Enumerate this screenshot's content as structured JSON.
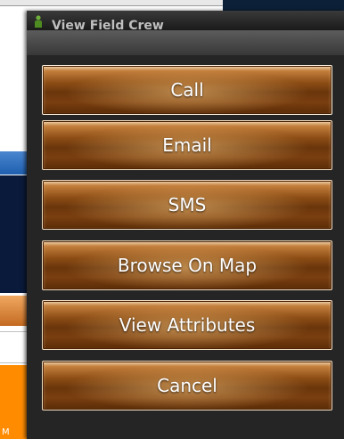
{
  "dialog": {
    "title": "View Field Crew"
  },
  "menu": {
    "items": [
      {
        "label": "Call"
      },
      {
        "label": "Email"
      },
      {
        "label": "SMS"
      },
      {
        "label": "Browse On Map"
      },
      {
        "label": "View Attributes"
      },
      {
        "label": "Cancel"
      }
    ]
  },
  "background": {
    "partial_text": "M"
  },
  "colors": {
    "button_base": "#6a350b",
    "button_highlight": "#e7c296",
    "dialog_bg": "#252525",
    "bg_navy": "#0a1a3a",
    "bg_orange": "#ff8c00"
  }
}
